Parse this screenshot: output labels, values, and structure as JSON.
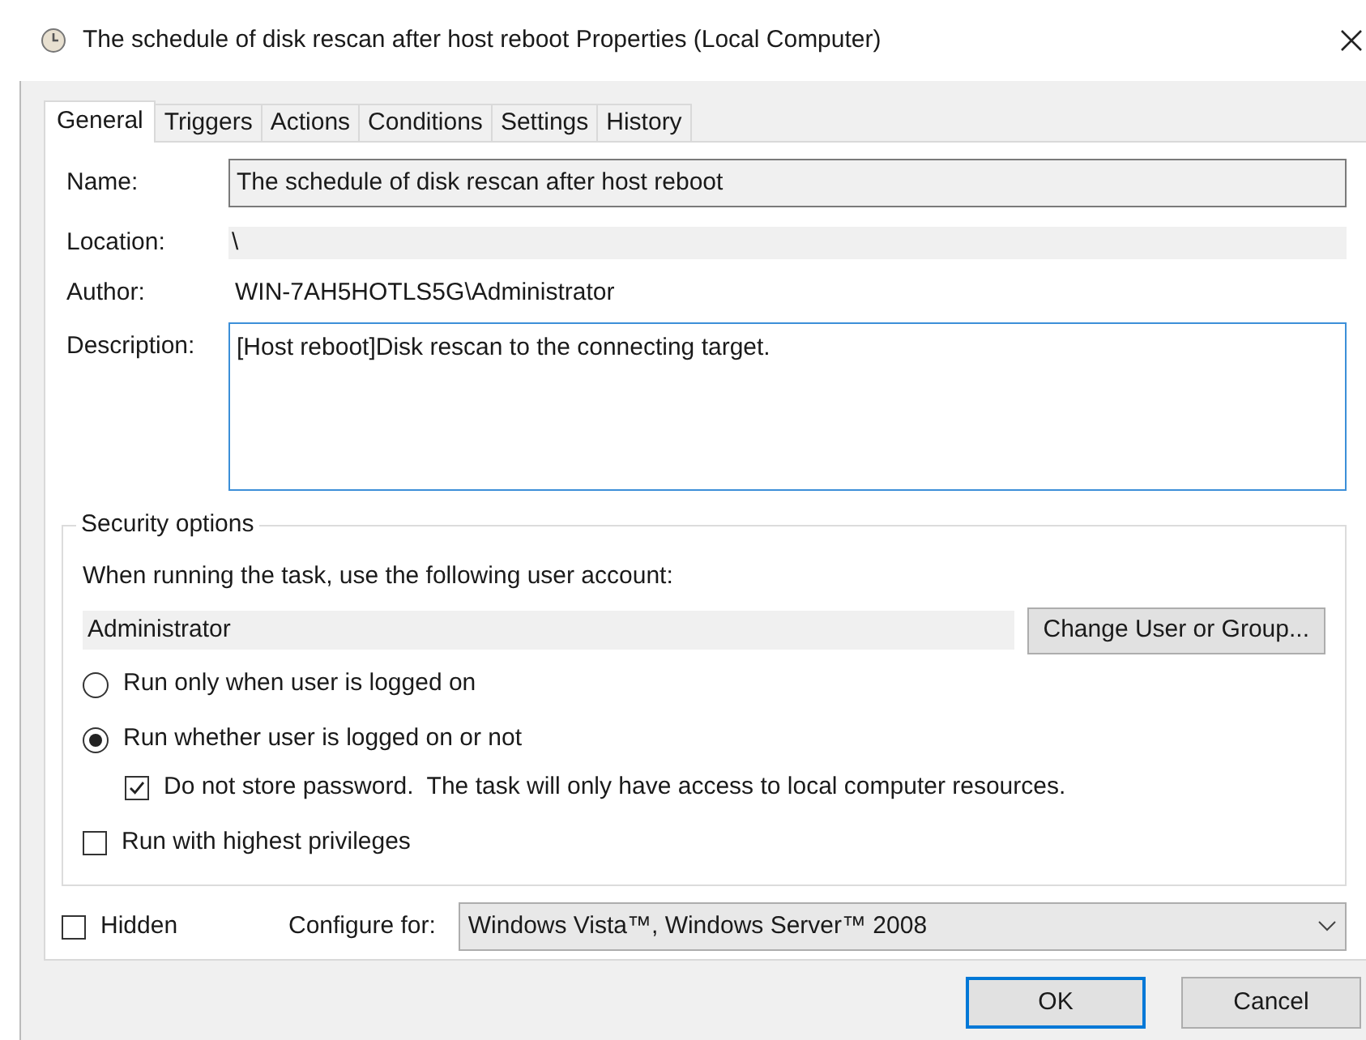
{
  "window": {
    "title": "The schedule of disk rescan after host reboot Properties (Local Computer)"
  },
  "tabs": [
    {
      "label": "General",
      "selected": true
    },
    {
      "label": "Triggers",
      "selected": false
    },
    {
      "label": "Actions",
      "selected": false
    },
    {
      "label": "Conditions",
      "selected": false
    },
    {
      "label": "Settings",
      "selected": false
    },
    {
      "label": "History",
      "selected": false
    }
  ],
  "name": {
    "label": "Name:",
    "value": "The schedule of disk rescan after host reboot"
  },
  "location": {
    "label": "Location:",
    "value": "\\"
  },
  "author": {
    "label": "Author:",
    "value": "WIN-7AH5HOTLS5G\\Administrator"
  },
  "description": {
    "label": "Description:",
    "value": "[Host reboot]Disk rescan to the connecting target."
  },
  "security": {
    "title": "Security options",
    "prompt": "When running the task, use the following user account:",
    "account": "Administrator",
    "change_button": "Change User or Group...",
    "options": [
      {
        "kind": "radio",
        "label": "Run only when user is logged on",
        "selected": false
      },
      {
        "kind": "radio",
        "label": "Run whether user is logged on or not",
        "selected": true
      },
      {
        "kind": "checkbox",
        "label": "Do not store password.  The task will only have access to local computer resources.",
        "checked": true,
        "indent": true
      },
      {
        "kind": "checkbox",
        "label": "Run with highest privileges",
        "checked": false
      }
    ]
  },
  "hidden": {
    "label": "Hidden",
    "checked": false
  },
  "configure": {
    "label": "Configure for:",
    "value": "Windows Vista™, Windows Server™ 2008"
  },
  "buttons": [
    {
      "label": "OK",
      "default": true
    },
    {
      "label": "Cancel",
      "default": false
    }
  ]
}
